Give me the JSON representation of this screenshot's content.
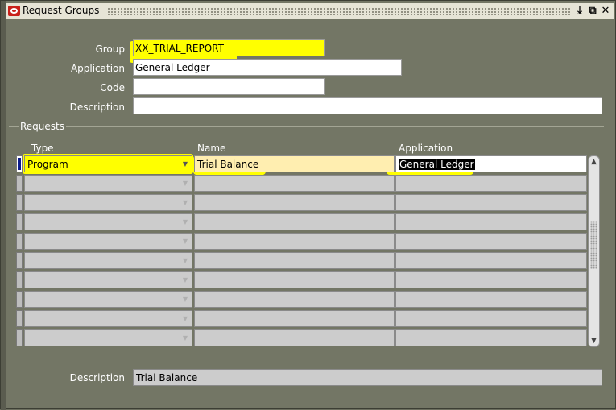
{
  "window": {
    "title": "Request Groups",
    "controls": [
      "minimize-icon",
      "maximize-icon",
      "close-icon"
    ]
  },
  "header_form": {
    "group": {
      "label": "Group",
      "value": "XX_TRIAL_REPORT"
    },
    "application": {
      "label": "Application",
      "value": "General Ledger"
    },
    "code": {
      "label": "Code",
      "value": ""
    },
    "description": {
      "label": "Description",
      "value": ""
    }
  },
  "requests": {
    "section_label": "Requests",
    "columns": [
      "Type",
      "Name",
      "Application"
    ],
    "rows": [
      {
        "type": "Program",
        "name": "Trial Balance",
        "application": "General Ledger"
      },
      {
        "type": "",
        "name": "",
        "application": ""
      },
      {
        "type": "",
        "name": "",
        "application": ""
      },
      {
        "type": "",
        "name": "",
        "application": ""
      },
      {
        "type": "",
        "name": "",
        "application": ""
      },
      {
        "type": "",
        "name": "",
        "application": ""
      },
      {
        "type": "",
        "name": "",
        "application": ""
      },
      {
        "type": "",
        "name": "",
        "application": ""
      },
      {
        "type": "",
        "name": "",
        "application": ""
      },
      {
        "type": "",
        "name": "",
        "application": ""
      }
    ]
  },
  "footer": {
    "description_label": "Description",
    "description_value": "Trial Balance"
  },
  "colors": {
    "canvas": "#737665",
    "highlight": "#ffff00",
    "field_bg": "#ffffff",
    "cell_bg": "#cccccc",
    "selection": "#000000"
  }
}
